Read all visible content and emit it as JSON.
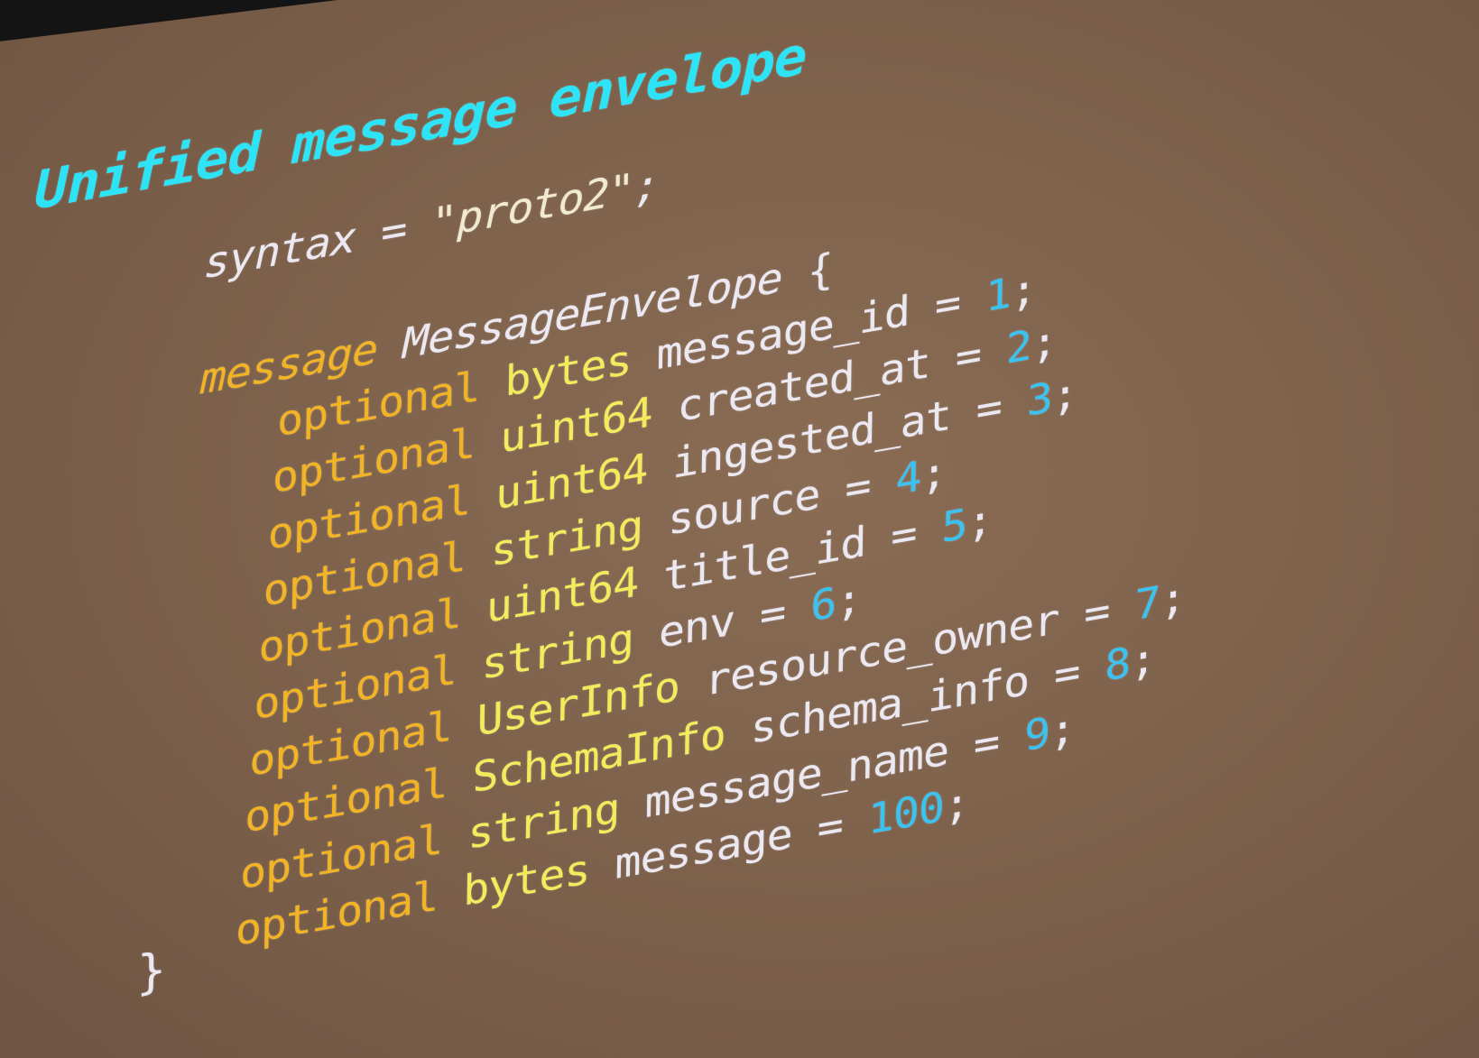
{
  "slide": {
    "title": "Unified message envelope",
    "syntax_line": {
      "keyword": "syntax",
      "equals": " = ",
      "value": "\"proto2\"",
      "terminator": ";"
    },
    "message_decl": {
      "keyword": "message",
      "name": "MessageEnvelope",
      "open_brace": "{",
      "close_brace": "}"
    },
    "fields": [
      {
        "label": "optional",
        "type": "bytes",
        "name": "message_id",
        "number": "1"
      },
      {
        "label": "optional",
        "type": "uint64",
        "name": "created_at",
        "number": "2"
      },
      {
        "label": "optional",
        "type": "uint64",
        "name": "ingested_at",
        "number": "3"
      },
      {
        "label": "optional",
        "type": "string",
        "name": "source",
        "number": "4"
      },
      {
        "label": "optional",
        "type": "uint64",
        "name": "title_id",
        "number": "5"
      },
      {
        "label": "optional",
        "type": "string",
        "name": "env",
        "number": "6"
      },
      {
        "label": "optional",
        "type": "UserInfo",
        "name": "resource_owner",
        "number": "7"
      },
      {
        "label": "optional",
        "type": "SchemaInfo",
        "name": "schema_info",
        "number": "8"
      },
      {
        "label": "optional",
        "type": "string",
        "name": "message_name",
        "number": "9"
      },
      {
        "label": "optional",
        "type": "bytes",
        "name": "message",
        "number": "100"
      }
    ],
    "punctuation": {
      "equals": " = ",
      "terminator": ";"
    },
    "colors": {
      "title": "#2ee3f5",
      "keyword": "#f2b425",
      "type": "#f3ea5c",
      "number": "#3cc2f1",
      "identifier": "#ece8f2",
      "background": "#7e624c"
    }
  }
}
